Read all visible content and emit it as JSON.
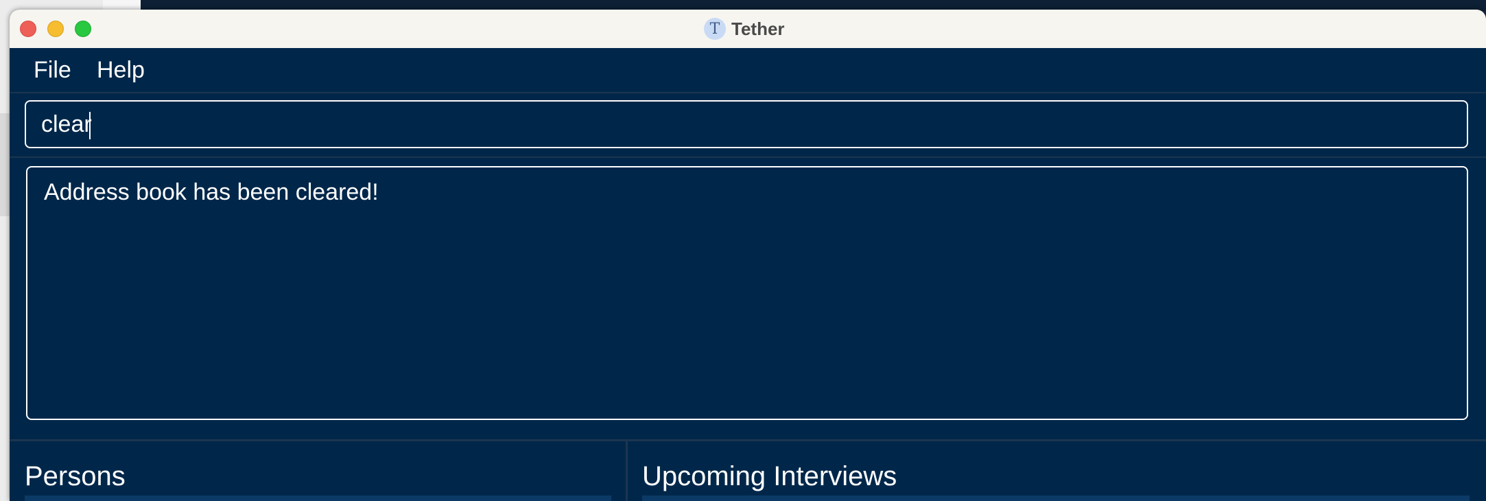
{
  "window": {
    "title": "Tether",
    "app_icon_glyph": "T"
  },
  "menu": {
    "items": [
      "File",
      "Help"
    ]
  },
  "command": {
    "value": "clear"
  },
  "result": {
    "message": "Address book has been cleared!"
  },
  "panels": {
    "persons_title": "Persons",
    "interviews_title": "Upcoming Interviews"
  },
  "colors": {
    "background": "#00274a",
    "titlebar": "#f6f5f0",
    "text": "#ffffff",
    "close": "#ee5f57",
    "minimize": "#f5bd2f",
    "maximize": "#28c840"
  }
}
